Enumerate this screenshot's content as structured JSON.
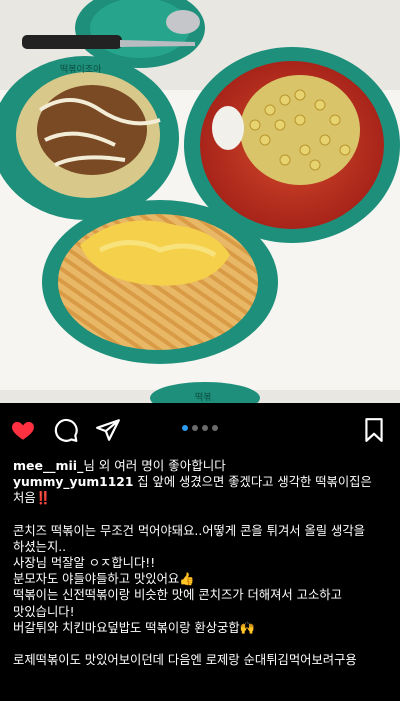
{
  "post": {
    "liked_by_user": "mee__mii_",
    "likes_text": "님 외 여러 명이 좋아합니다",
    "author": "yummy_yum1121",
    "caption_first": "집 앞에 생겼으면 좋겠다고 생각한 떡볶이집은 처음",
    "caption_first_emoji": "‼️",
    "caption_rest": "\n\n콘치즈 떡볶이는 무조건 먹어야돼요..어떻게 콘을 튀겨서 올릴 생각을 하셨는지..\n사장님 먹잘알 ㅇㅈ합니다!!\n분모자도 야들야들하고 맛있어요👍\n떡볶이는 신전떡볶이랑 비슷한 맛에 콘치즈가 더해져서 고소하고 맛있습니다!\n버갈튀와 치킨마요덮밥도 떡볶이랑 환상궁합🙌\n\n로제떡볶이도 맛있어보이던데 다음엔 로제랑 순대튀김먹어보려구용",
    "image_count": 4,
    "current_image": 1
  },
  "photo": {
    "plate_text": "떡볶이조아",
    "plate_text_bottom": "떡볶"
  },
  "icons": {
    "like": "heart-icon",
    "comment": "comment-icon",
    "share": "send-icon",
    "save": "bookmark-icon"
  },
  "colors": {
    "heart": "#ff3040",
    "carousel_active": "#2d9bf0",
    "plate_green": "#1d8f7a"
  }
}
